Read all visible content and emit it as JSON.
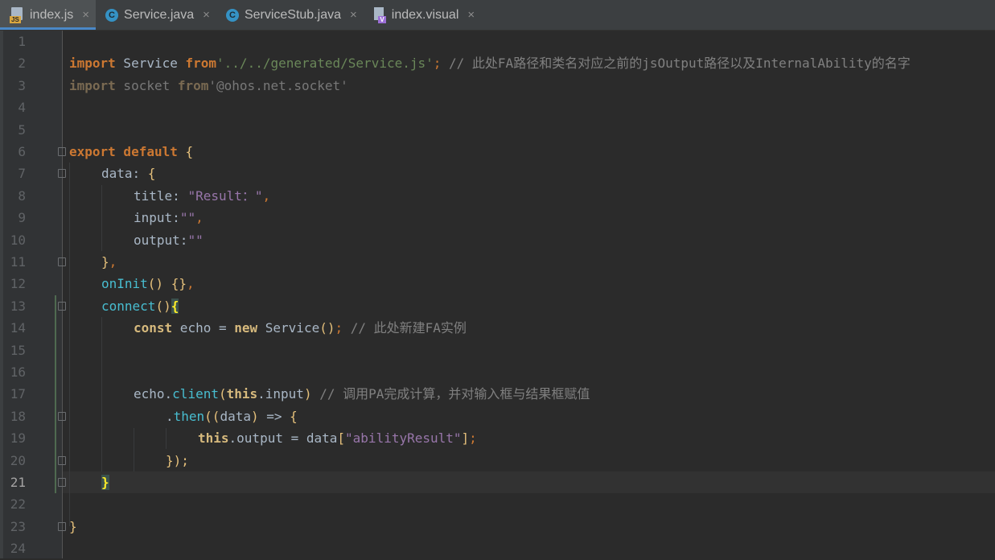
{
  "tabs": [
    {
      "label": "index.js",
      "icon": "js-file-icon",
      "active": true
    },
    {
      "label": "Service.java",
      "icon": "java-class-icon",
      "active": false
    },
    {
      "label": "ServiceStub.java",
      "icon": "java-class-icon",
      "active": false
    },
    {
      "label": "index.visual",
      "icon": "visual-file-icon",
      "active": false
    }
  ],
  "tab_close_glyph": "×",
  "icon_labels": {
    "js": "JS",
    "class": "C",
    "visual": "V"
  },
  "current_line": 21,
  "line_numbers": [
    "1",
    "2",
    "3",
    "4",
    "5",
    "6",
    "7",
    "8",
    "9",
    "10",
    "11",
    "12",
    "13",
    "14",
    "15",
    "16",
    "17",
    "18",
    "19",
    "20",
    "21",
    "22",
    "23",
    "24"
  ],
  "code": {
    "l2": {
      "kw1": "import",
      "name": " Service ",
      "kw2": "from",
      "str": "'../../generated/Service.js'",
      "semi": ";",
      "comment": " // 此处FA路径和类名对应之前的jsOutput路径以及InternalAbility的名字"
    },
    "l3": {
      "kw1": "import",
      "name": " socket ",
      "kw2": "from",
      "str": "'@ohos.net.socket'"
    },
    "l6": {
      "kw": "export default ",
      "brace": "{"
    },
    "l7": {
      "key": "data",
      "colon": ": ",
      "brace": "{"
    },
    "l8": {
      "key": "title",
      "colon": ": ",
      "str": "\"Result：\"",
      "comma": ","
    },
    "l9": {
      "key": "input",
      "colon": ":",
      "str": "\"\"",
      "comma": ","
    },
    "l10": {
      "key": "output",
      "colon": ":",
      "str": "\"\""
    },
    "l11": {
      "brace": "}",
      "comma": ","
    },
    "l12": {
      "fn": "onInit",
      "paren": "()",
      "sp": " ",
      "braces": "{}",
      "comma": ","
    },
    "l13": {
      "fn": "connect",
      "paren": "()",
      "brace": "{"
    },
    "l14": {
      "kw": "const",
      "name": " echo = ",
      "kw2": "new",
      "cls": " Service",
      "paren": "()",
      "semi": ";",
      "comment": " // 此处新建FA实例"
    },
    "l17": {
      "obj": "echo",
      "dot": ".",
      "fn": "client",
      "p1": "(",
      "kw": "this",
      "prop": ".input",
      "p2": ")",
      "comment": " // 调用PA完成计算，并对输入框与结果框赋值"
    },
    "l18": {
      "dot": ".",
      "fn": "then",
      "p1": "((",
      "arg": "data",
      "p2": ")",
      "arrow": " => ",
      "brace": "{"
    },
    "l19": {
      "kw": "this",
      "rest": ".output = data",
      "b1": "[",
      "str": "\"abilityResult\"",
      "b2": "]",
      "semi": ";"
    },
    "l20": {
      "close": "});"
    },
    "l21": {
      "brace": "}"
    },
    "l23": {
      "brace": "}"
    }
  }
}
